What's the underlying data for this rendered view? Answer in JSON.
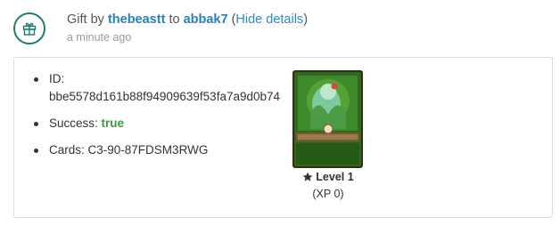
{
  "header": {
    "prefix": "Gift by",
    "sender": "thebeastt",
    "to_word": "to",
    "recipient": "abbak7",
    "toggle_label": "Hide details",
    "time": "a minute ago"
  },
  "details": {
    "id_label": "ID:",
    "id_value": "bbe5578d161b88f94909639f53fa7a9d0b74",
    "success_label": "Success:",
    "success_value": "true",
    "cards_label": "Cards:",
    "cards_value": "C3-90-87FDSM3RWG"
  },
  "card": {
    "level": "Level 1",
    "xp": "(XP 0)"
  },
  "icons": {
    "gift": "gift-icon",
    "level": "star-icon"
  },
  "colors": {
    "icon": "#1f7a72",
    "link": "#2a8bd0",
    "success": "#3c9a3c",
    "card_bg": "#2d6a1e"
  }
}
